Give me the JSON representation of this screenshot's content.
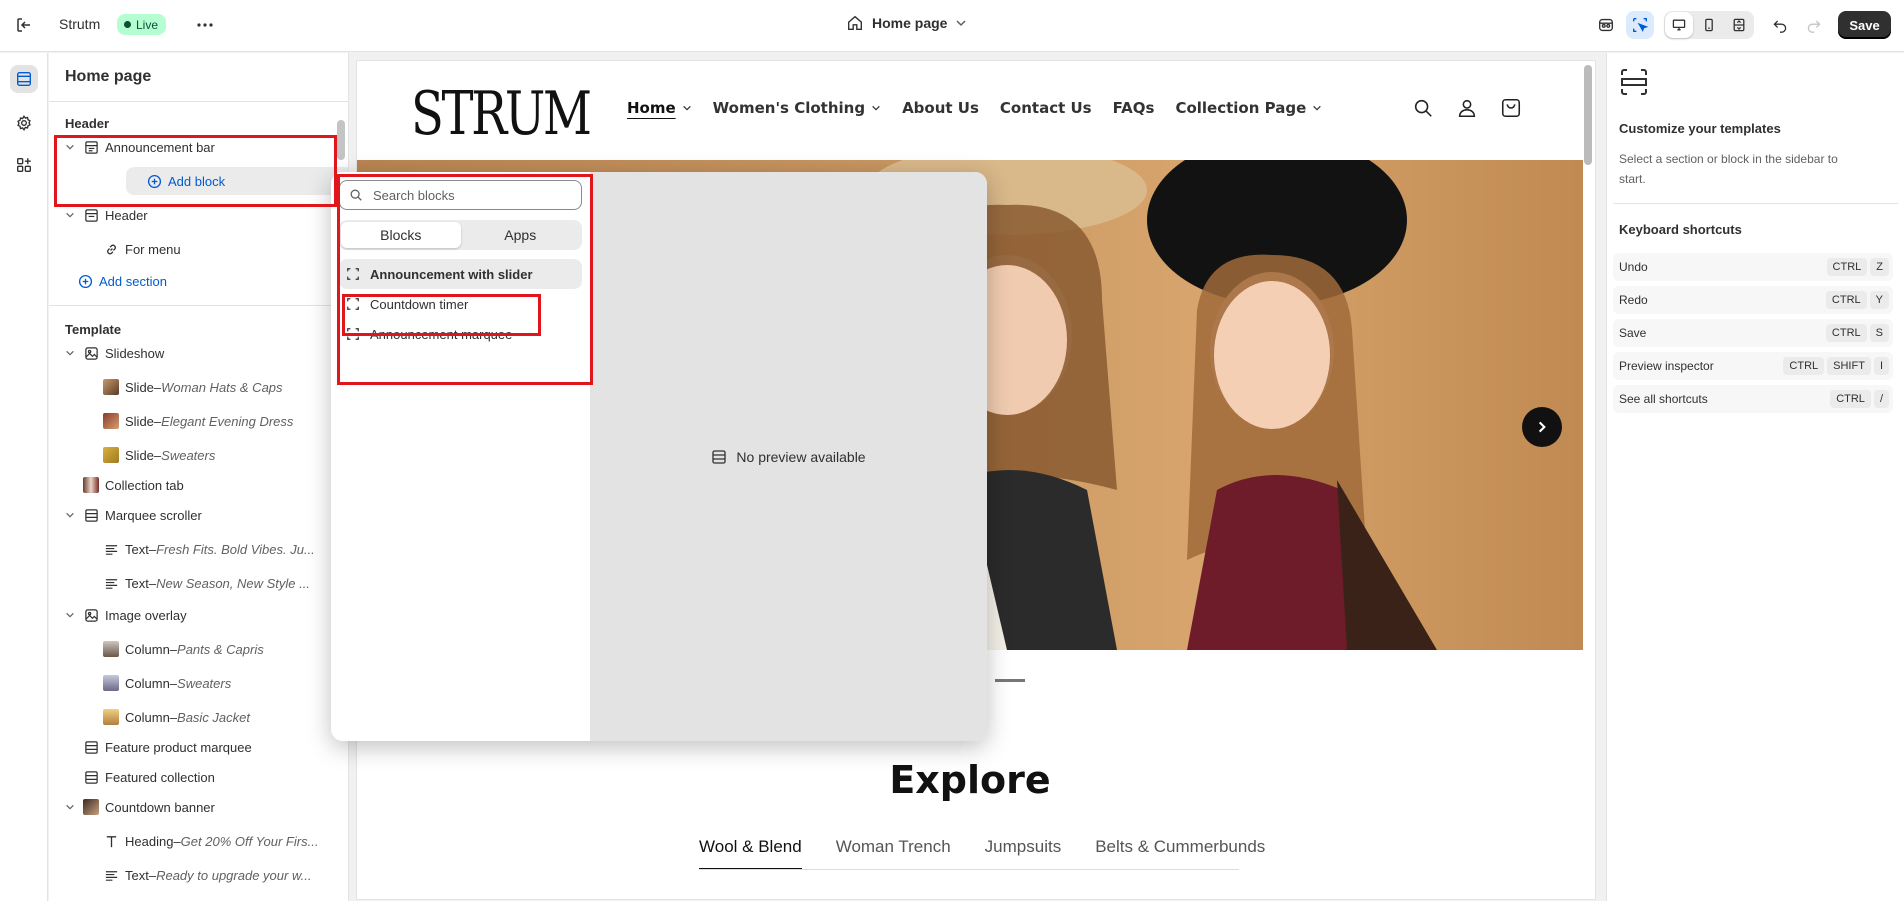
{
  "topbar": {
    "store_name": "Strutm",
    "status": "Live",
    "page_selector": "Home page",
    "save_label": "Save"
  },
  "sidebar": {
    "title": "Home page",
    "header_group": "Header",
    "template_group": "Template",
    "items": [
      {
        "label": "Announcement bar",
        "sub": ""
      },
      {
        "label": "Add block",
        "sub": ""
      },
      {
        "label": "Header",
        "sub": ""
      },
      {
        "label": "For menu",
        "sub": ""
      },
      {
        "label": "Add section",
        "sub": ""
      },
      {
        "label": "Slideshow",
        "sub": ""
      },
      {
        "label": "Slide",
        "sub": "Woman Hats & Caps"
      },
      {
        "label": "Slide",
        "sub": "Elegant Evening Dress"
      },
      {
        "label": "Slide",
        "sub": "Sweaters"
      },
      {
        "label": "Collection tab",
        "sub": ""
      },
      {
        "label": "Marquee scroller",
        "sub": ""
      },
      {
        "label": "Text",
        "sub": "Fresh Fits. Bold Vibes. Ju..."
      },
      {
        "label": "Text",
        "sub": "New Season, New Style ..."
      },
      {
        "label": "Image overlay",
        "sub": ""
      },
      {
        "label": "Column",
        "sub": "Pants & Capris"
      },
      {
        "label": "Column",
        "sub": "Sweaters"
      },
      {
        "label": "Column",
        "sub": "Basic Jacket"
      },
      {
        "label": "Feature product marquee",
        "sub": ""
      },
      {
        "label": "Featured collection",
        "sub": ""
      },
      {
        "label": "Countdown banner",
        "sub": ""
      },
      {
        "label": "Heading",
        "sub": "Get 20% Off Your Firs..."
      },
      {
        "label": "Text",
        "sub": "Ready to upgrade your w..."
      }
    ],
    "separator": " – "
  },
  "block_picker": {
    "search_placeholder": "Search blocks",
    "tabs": [
      "Blocks",
      "Apps"
    ],
    "items": [
      "Announcement with slider",
      "Countdown timer",
      "Announcement marquee"
    ],
    "no_preview": "No preview available"
  },
  "storefront": {
    "logo": "STRUM",
    "nav": [
      "Home",
      "Women's Clothing",
      "About Us",
      "Contact Us",
      "FAQs",
      "Collection Page"
    ],
    "section_title": "Explore",
    "collection_tabs": [
      "Wool & Blend",
      "Woman Trench",
      "Jumpsuits",
      "Belts & Cummerbunds"
    ]
  },
  "right_panel": {
    "title": "Customize your templates",
    "description": "Select a section or block in the sidebar to start.",
    "shortcuts_title": "Keyboard shortcuts",
    "shortcuts": [
      {
        "label": "Undo",
        "keys": [
          "CTRL",
          "Z"
        ]
      },
      {
        "label": "Redo",
        "keys": [
          "CTRL",
          "Y"
        ]
      },
      {
        "label": "Save",
        "keys": [
          "CTRL",
          "S"
        ]
      },
      {
        "label": "Preview inspector",
        "keys": [
          "CTRL",
          "SHIFT",
          "I"
        ]
      },
      {
        "label": "See all shortcuts",
        "keys": [
          "CTRL",
          "/"
        ]
      }
    ]
  },
  "colors": {
    "accent": "#005bd3",
    "live_badge": "#b4fed2",
    "annotation": "#e0161c"
  }
}
